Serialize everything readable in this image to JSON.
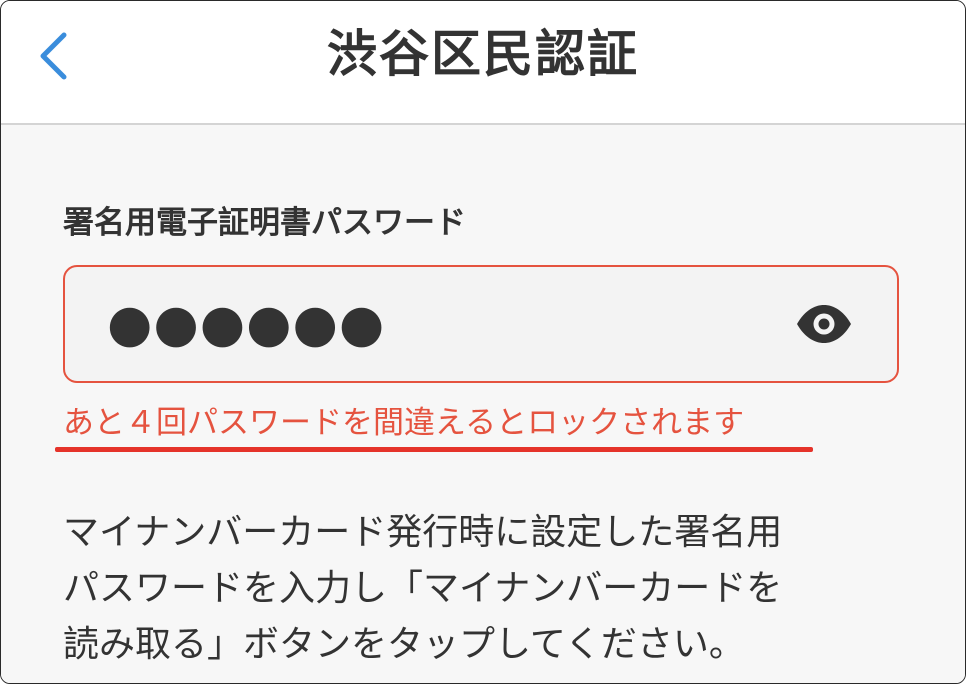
{
  "header": {
    "title": "渋谷区民認証",
    "back_icon": "chevron-left-icon"
  },
  "form": {
    "label": "署名用電子証明書パスワード",
    "password_value": "●●●●●●",
    "visibility_icon": "eye-icon",
    "error_message": "あと４回パスワードを間違えるとロックされます"
  },
  "description": {
    "lines": [
      "マイナンバーカード発行時に設定した署名用",
      "パスワードを入力し「マイナンバーカードを",
      "読み取る」ボタンをタップしてください。"
    ]
  },
  "colors": {
    "accent_blue": "#3a8ddc",
    "error_red": "#e5533f",
    "text_dark": "#333333",
    "background": "#f7f7f7"
  }
}
